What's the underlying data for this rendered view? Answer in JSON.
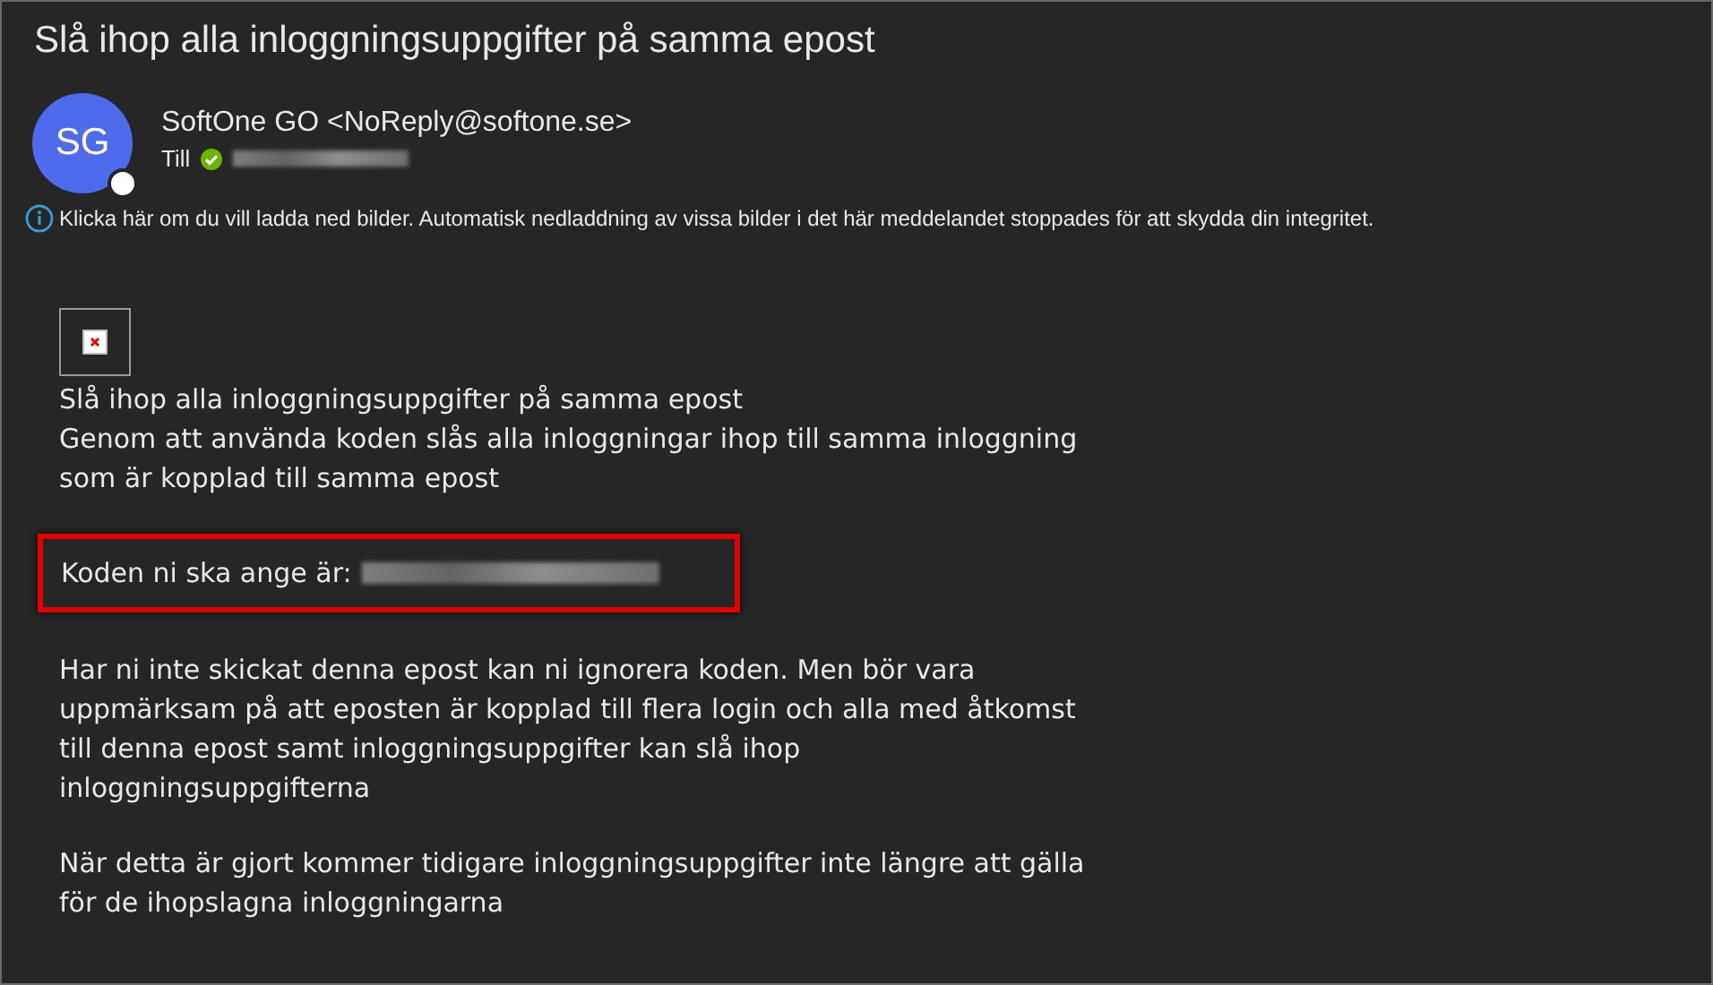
{
  "subject": "Slå ihop alla inloggningsuppgifter på samma epost",
  "sender": {
    "initials": "SG",
    "name": "SoftOne GO <NoReply@softone.se>",
    "to_label": "Till"
  },
  "info_bar": "Klicka här om du vill ladda ned bilder. Automatisk nedladdning av vissa bilder i det här meddelandet stoppades för att skydda din integritet.",
  "body": [
    {
      "kind": "text",
      "lines": [
        "Slå ihop alla inloggningsuppgifter på samma epost",
        "Genom att använda koden slås alla inloggningar ihop till samma inloggning som är kopplad till samma epost"
      ]
    },
    {
      "kind": "code",
      "label": "Koden ni ska ange är:"
    },
    {
      "kind": "text",
      "lines": [
        "Har ni inte skickat denna epost kan ni ignorera koden. Men bör vara uppmärksam på att eposten är kopplad till flera login och alla med åtkomst till denna epost samt inloggningsuppgifter kan slå ihop inloggningsuppgifterna"
      ]
    },
    {
      "kind": "text",
      "lines": [
        "När detta är gjort kommer tidigare inloggningsuppgifter inte längre att gälla för de ihopslagna inloggningarna"
      ]
    }
  ]
}
